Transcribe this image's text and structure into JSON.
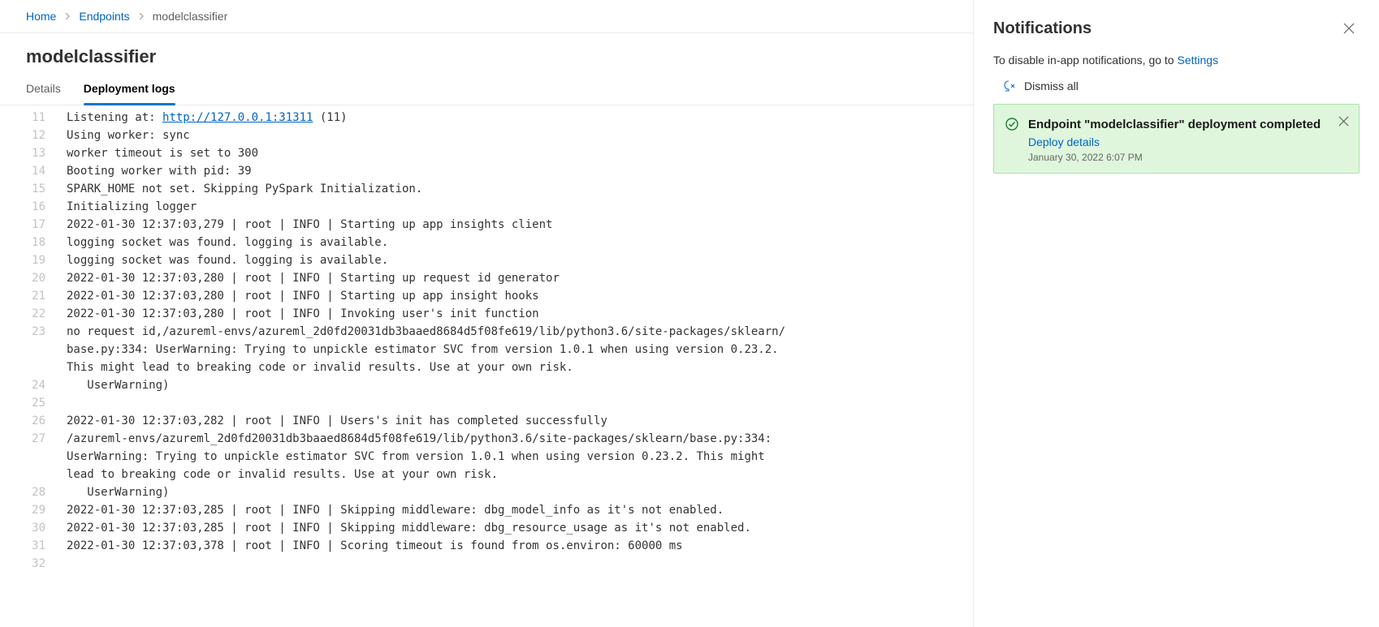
{
  "breadcrumb": {
    "home": "Home",
    "endpoints": "Endpoints",
    "current": "modelclassifier"
  },
  "page": {
    "title": "modelclassifier"
  },
  "tabs": {
    "details": "Details",
    "deployment_logs": "Deployment logs"
  },
  "log": {
    "lines": [
      {
        "n": 11,
        "t": "Listening at: http://127.0.0.1:31311 (11)"
      },
      {
        "n": 12,
        "t": "Using worker: sync"
      },
      {
        "n": 13,
        "t": "worker timeout is set to 300"
      },
      {
        "n": 14,
        "t": "Booting worker with pid: 39"
      },
      {
        "n": 15,
        "t": "SPARK_HOME not set. Skipping PySpark Initialization."
      },
      {
        "n": 16,
        "t": "Initializing logger"
      },
      {
        "n": 17,
        "t": "2022-01-30 12:37:03,279 | root | INFO | Starting up app insights client"
      },
      {
        "n": 18,
        "t": "logging socket was found. logging is available."
      },
      {
        "n": 19,
        "t": "logging socket was found. logging is available."
      },
      {
        "n": 20,
        "t": "2022-01-30 12:37:03,280 | root | INFO | Starting up request id generator"
      },
      {
        "n": 21,
        "t": "2022-01-30 12:37:03,280 | root | INFO | Starting up app insight hooks"
      },
      {
        "n": 22,
        "t": "2022-01-30 12:37:03,280 | root | INFO | Invoking user's init function"
      },
      {
        "n": 23,
        "t": "no request id,/azureml-envs/azureml_2d0fd20031db3baaed8684d5f08fe619/lib/python3.6/site-packages/sklearn/base.py:334: UserWarning: Trying to unpickle estimator SVC from version 1.0.1 when using version 0.23.2. This might lead to breaking code or invalid results. Use at your own risk."
      },
      {
        "n": 24,
        "t": "  UserWarning)",
        "indent": true
      },
      {
        "n": 25,
        "t": ""
      },
      {
        "n": 26,
        "t": "2022-01-30 12:37:03,282 | root | INFO | Users's init has completed successfully"
      },
      {
        "n": 27,
        "t": "/azureml-envs/azureml_2d0fd20031db3baaed8684d5f08fe619/lib/python3.6/site-packages/sklearn/base.py:334: UserWarning: Trying to unpickle estimator SVC from version 1.0.1 when using version 0.23.2. This might lead to breaking code or invalid results. Use at your own risk."
      },
      {
        "n": 28,
        "t": "  UserWarning)",
        "indent": true
      },
      {
        "n": 29,
        "t": "2022-01-30 12:37:03,285 | root | INFO | Skipping middleware: dbg_model_info as it's not enabled."
      },
      {
        "n": 30,
        "t": "2022-01-30 12:37:03,285 | root | INFO | Skipping middleware: dbg_resource_usage as it's not enabled."
      },
      {
        "n": 31,
        "t": "2022-01-30 12:37:03,378 | root | INFO | Scoring timeout is found from os.environ: 60000 ms"
      },
      {
        "n": 32,
        "t": ""
      }
    ]
  },
  "notifications": {
    "heading": "Notifications",
    "subtext_prefix": "To disable in-app notifications, go to ",
    "settings_link": "Settings",
    "dismiss_all": "Dismiss all",
    "items": [
      {
        "title": "Endpoint \"modelclassifier\" deployment completed",
        "link": "Deploy details",
        "time": "January 30, 2022 6:07 PM"
      }
    ]
  }
}
